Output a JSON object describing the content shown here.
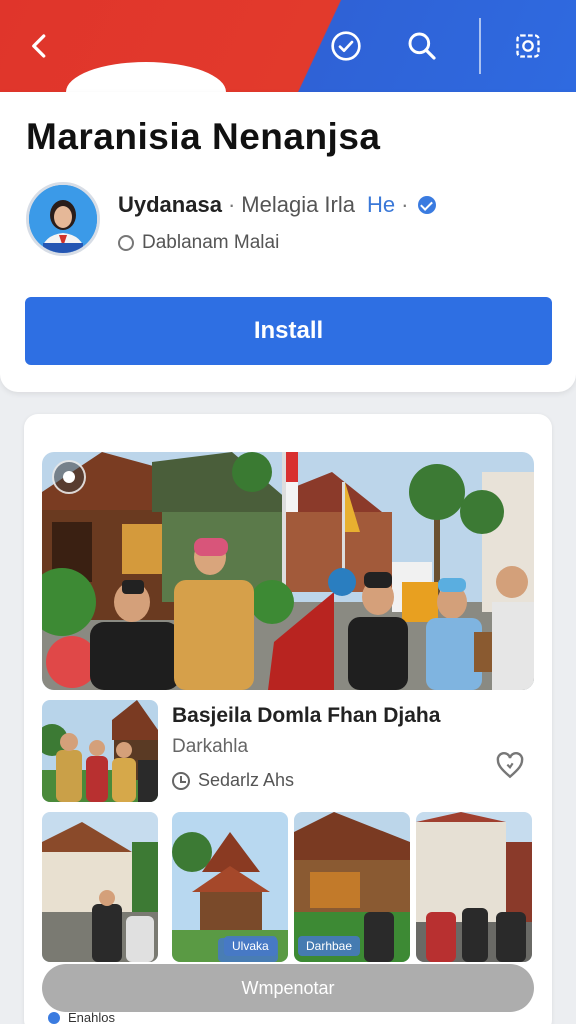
{
  "topbar": {
    "colors": {
      "left": "#e0352b",
      "right": "#2f6ae0"
    },
    "icons": [
      "back-arrow-icon",
      "check-circle-icon",
      "search-icon",
      "share-icon"
    ]
  },
  "app": {
    "title": "Maranisia Nenanjsa",
    "developer": "Uydanasa",
    "category": "Melagia Irla",
    "language": "He",
    "subtitle": "Dablanam Malai",
    "install_label": "Install",
    "accent_color": "#2e6fe3"
  },
  "featured": {
    "item_title": "Basjeila Domla Fhan Djaha",
    "item_subtitle": "Darkahla",
    "item_meta": "Sedarlz Ahs",
    "tags": [
      "Ulvaka",
      "Darhbae"
    ]
  },
  "bottom": {
    "pill_label": "Wmpenotar",
    "peek_label": "Enahlos"
  }
}
